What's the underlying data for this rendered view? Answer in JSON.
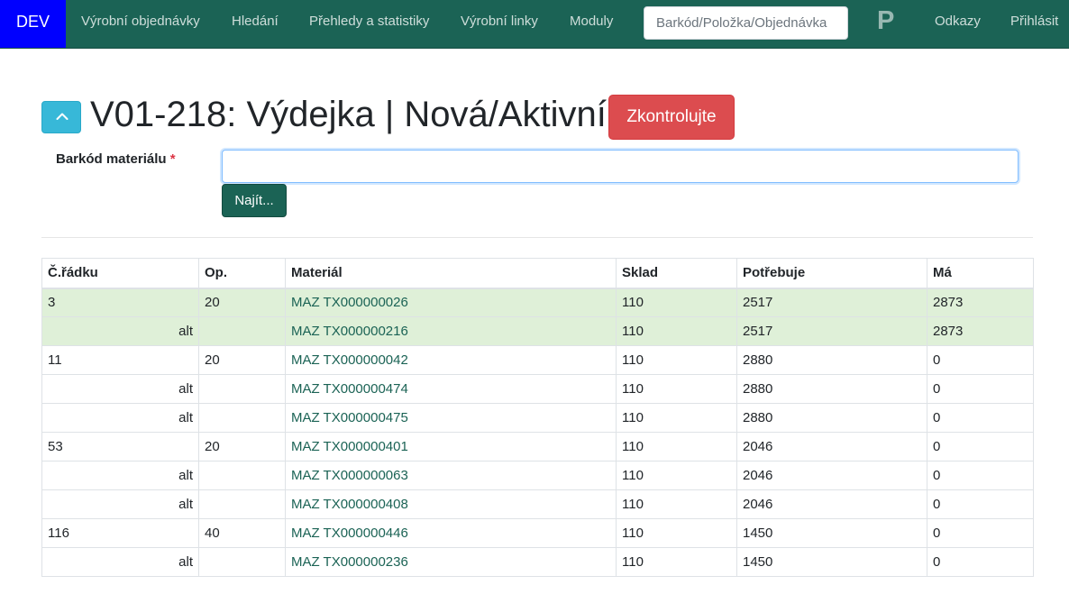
{
  "navbar": {
    "env": "DEV",
    "items": [
      {
        "label": "Výrobní objednávky",
        "name": "nav-production-orders"
      },
      {
        "label": "Hledání",
        "name": "nav-search"
      },
      {
        "label": "Přehledy a statistiky",
        "name": "nav-reports"
      },
      {
        "label": "Výrobní linky",
        "name": "nav-production-lines"
      },
      {
        "label": "Moduly",
        "name": "nav-modules"
      }
    ],
    "search_placeholder": "Barkód/Položka/Objednávka",
    "logo": "P",
    "links_label": "Odkazy",
    "login_label": "Přihlásit"
  },
  "header": {
    "title": "V01-218: Výdejka | Nová/Aktivní",
    "check_label": "Zkontrolujte",
    "collapse_icon": "chevron-up-icon"
  },
  "form": {
    "barcode_label": "Barkód materiálu",
    "required_mark": "*",
    "barcode_value": "",
    "find_label": "Najít..."
  },
  "colors": {
    "navbar": "#1b6355",
    "env_badge": "#0000ff",
    "check_button": "#dc4c4f",
    "collapse_button": "#37b8d8",
    "fulfilled_row": "#dff0d8"
  },
  "table": {
    "headers": [
      "Č.řádku",
      "Op.",
      "Materiál",
      "Sklad",
      "Potřebuje",
      "Má"
    ],
    "rows": [
      {
        "line": "3",
        "op": "20",
        "material": "MAZ TX000000026",
        "store": "110",
        "needs": "2517",
        "has": "2873",
        "ok": true,
        "alt": false
      },
      {
        "line": "alt",
        "op": "",
        "material": "MAZ TX000000216",
        "store": "110",
        "needs": "2517",
        "has": "2873",
        "ok": true,
        "alt": true
      },
      {
        "line": "11",
        "op": "20",
        "material": "MAZ TX000000042",
        "store": "110",
        "needs": "2880",
        "has": "0",
        "ok": false,
        "alt": false
      },
      {
        "line": "alt",
        "op": "",
        "material": "MAZ TX000000474",
        "store": "110",
        "needs": "2880",
        "has": "0",
        "ok": false,
        "alt": true
      },
      {
        "line": "alt",
        "op": "",
        "material": "MAZ TX000000475",
        "store": "110",
        "needs": "2880",
        "has": "0",
        "ok": false,
        "alt": true
      },
      {
        "line": "53",
        "op": "20",
        "material": "MAZ TX000000401",
        "store": "110",
        "needs": "2046",
        "has": "0",
        "ok": false,
        "alt": false
      },
      {
        "line": "alt",
        "op": "",
        "material": "MAZ TX000000063",
        "store": "110",
        "needs": "2046",
        "has": "0",
        "ok": false,
        "alt": true
      },
      {
        "line": "alt",
        "op": "",
        "material": "MAZ TX000000408",
        "store": "110",
        "needs": "2046",
        "has": "0",
        "ok": false,
        "alt": true
      },
      {
        "line": "116",
        "op": "40",
        "material": "MAZ TX000000446",
        "store": "110",
        "needs": "1450",
        "has": "0",
        "ok": false,
        "alt": false
      },
      {
        "line": "alt",
        "op": "",
        "material": "MAZ TX000000236",
        "store": "110",
        "needs": "1450",
        "has": "0",
        "ok": false,
        "alt": true
      }
    ]
  }
}
